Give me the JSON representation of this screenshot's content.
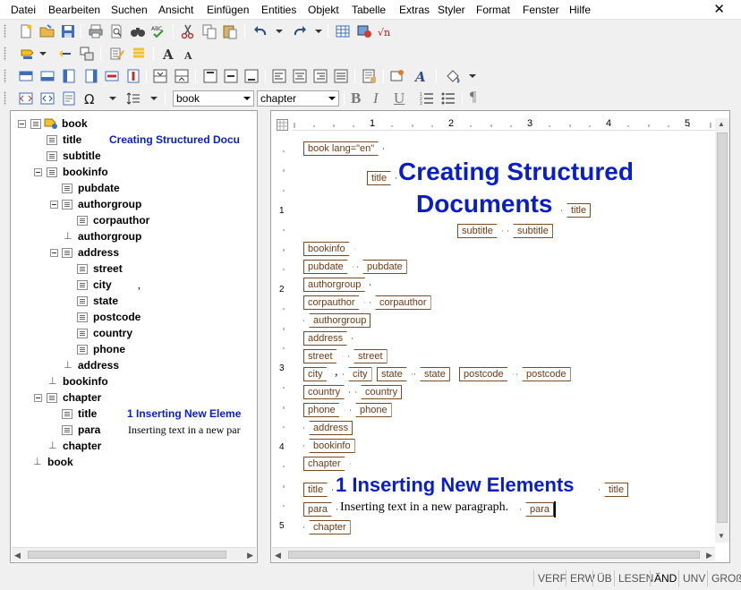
{
  "menu": [
    "Datei",
    "Bearbeiten",
    "Suchen",
    "Ansicht",
    "Einfügen",
    "Entities",
    "Objekt",
    "Tabelle",
    "Extras",
    "Styler",
    "Format",
    "Fenster",
    "Hilfe"
  ],
  "window": {
    "close_glyph": "✕"
  },
  "toolbar": {
    "element_combo": "book",
    "style_combo": "chapter",
    "bold": "B",
    "italic": "I",
    "underline": "U",
    "pilcrow": "¶",
    "omega": "Ω",
    "font_big": "A",
    "font_small": "A",
    "sqrt": "√n",
    "spell": "ABC"
  },
  "tree": {
    "nodes": [
      {
        "name": "book"
      },
      {
        "name": "title",
        "value": "Creating Structured Docu"
      },
      {
        "name": "subtitle"
      },
      {
        "name": "bookinfo"
      },
      {
        "name": "pubdate"
      },
      {
        "name": "authorgroup"
      },
      {
        "name": "corpauthor"
      },
      {
        "name": "authorgroup"
      },
      {
        "name": "address"
      },
      {
        "name": "street"
      },
      {
        "name": "city",
        "value": ","
      },
      {
        "name": "state"
      },
      {
        "name": "postcode"
      },
      {
        "name": "country"
      },
      {
        "name": "phone"
      },
      {
        "name": "address"
      },
      {
        "name": "bookinfo"
      },
      {
        "name": "chapter"
      },
      {
        "name": "title",
        "value": "1 Inserting New Eleme"
      },
      {
        "name": "para",
        "value": "Inserting text in a new par"
      },
      {
        "name": "chapter"
      },
      {
        "name": "book"
      }
    ]
  },
  "ruler": {
    "marks": [
      "1",
      "2",
      "3",
      "4",
      "5"
    ],
    "vmarks": [
      "1",
      "2",
      "3",
      "4",
      "5"
    ]
  },
  "editor": {
    "tags": {
      "book_open": "book lang=\"en\"",
      "title": "title",
      "subtitle": "subtitle",
      "bookinfo": "bookinfo",
      "pubdate": "pubdate",
      "authorgroup": "authorgroup",
      "corpauthor": "corpauthor",
      "address": "address",
      "street": "street",
      "city": "city",
      "state": "state",
      "postcode": "postcode",
      "country": "country",
      "phone": "phone",
      "chapter": "chapter",
      "para": "para"
    },
    "heading_line1": "Creating Structured",
    "heading_line2": "Documents",
    "comma": ",",
    "chapter_title": "1 Inserting New Elements",
    "para_text": "Inserting text in a new paragraph."
  },
  "status": [
    "VERF",
    "ERW",
    "ÜB",
    "LESEN",
    "ÄND",
    "UNV",
    "GROß"
  ],
  "status_active": "ÄND",
  "colors": {
    "tag_border": "#7a4a20",
    "tag_text": "#6b3a16",
    "heading": "#0a1ec8"
  }
}
